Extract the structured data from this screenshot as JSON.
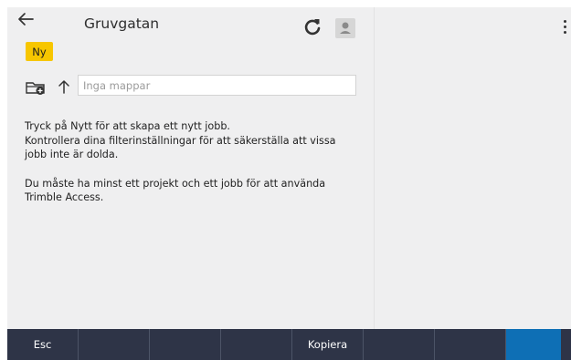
{
  "header": {
    "title": "Gruvgatan",
    "back_icon": "arrow-left-icon",
    "refresh_icon": "refresh-icon",
    "avatar_icon": "user-avatar-icon"
  },
  "new_button": {
    "label": "Ny",
    "color": "#f7c600"
  },
  "folder": {
    "icon": "folder-add-icon",
    "up_icon": "arrow-up-icon",
    "placeholder": "Inga mappar"
  },
  "messages": {
    "line1": "Tryck på Nytt för att skapa ett nytt jobb.",
    "line2": "Kontrollera dina filterinställningar för att säkerställa att vissa jobb inte är dolda.",
    "line3": "Du måste ha minst ett projekt och ett jobb för att använda Trimble Access."
  },
  "right_panel": {
    "menu_icon": "more-vertical-icon"
  },
  "bottom_bar": {
    "color": "#2e3447",
    "accent_color": "#0e6fb5",
    "keys": [
      "Esc",
      "",
      "",
      "",
      "Kopiera",
      "",
      "",
      ""
    ]
  }
}
